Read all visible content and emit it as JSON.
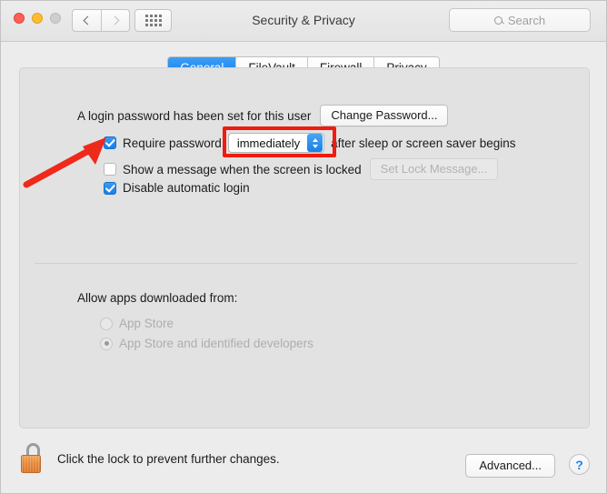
{
  "window": {
    "title": "Security & Privacy",
    "traffic_lights": [
      "close",
      "minimize",
      "zoom"
    ],
    "nav": {
      "back": "back-chevron",
      "forward": "forward-chevron"
    },
    "grid_button": "show-all-preferences",
    "search": {
      "placeholder": "Search",
      "value": "",
      "icon": "search-icon"
    }
  },
  "tabs": [
    {
      "label": "General",
      "active": true
    },
    {
      "label": "FileVault",
      "active": false
    },
    {
      "label": "Firewall",
      "active": false
    },
    {
      "label": "Privacy",
      "active": false
    }
  ],
  "general": {
    "login_password_text": "A login password has been set for this user",
    "change_password_button": "Change Password...",
    "require_password": {
      "checked": true,
      "label_before": "Require password",
      "value": "immediately",
      "label_after": "after sleep or screen saver begins",
      "highlighted": true
    },
    "show_message": {
      "checked": false,
      "label": "Show a message when the screen is locked",
      "button": "Set Lock Message...",
      "button_disabled": true
    },
    "disable_auto_login": {
      "checked": true,
      "label": "Disable automatic login"
    }
  },
  "allow_apps": {
    "title": "Allow apps downloaded from:",
    "disabled": true,
    "options": [
      {
        "label": "App Store",
        "selected": false
      },
      {
        "label": "App Store and identified developers",
        "selected": true
      }
    ]
  },
  "footer": {
    "lock_icon": "unlocked-padlock-icon",
    "lock_text": "Click the lock to prevent further changes.",
    "advanced_button": "Advanced...",
    "help_button": "?"
  },
  "annotations": {
    "arrow_color": "#ee2a1b",
    "highlight_color": "#ef1b10",
    "arrow_points_to": "require-password-checkbox"
  },
  "colors": {
    "accent_blue": "#1b7fe9",
    "window_bg": "#ececec",
    "panel_bg": "#e2e2e2",
    "annotation_red": "#ee2a1b"
  }
}
